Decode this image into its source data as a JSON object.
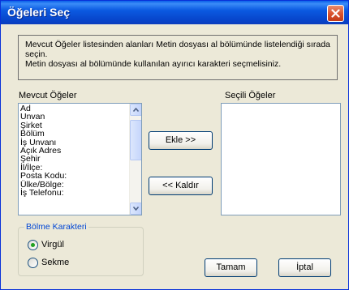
{
  "window": {
    "title": "Öğeleri Seç"
  },
  "description": {
    "line1": "Mevcut Öğeler listesinden alanları Metin dosyası al bölümünde listelendiği sırada seçin.",
    "line2": "Metin dosyası al bölümünde kullanılan ayırıcı karakteri seçmelisiniz."
  },
  "available": {
    "label": "Mevcut Öğeler",
    "items": [
      "Ad",
      "Unvan",
      "Şirket",
      "Bölüm",
      "İş Unvanı",
      "Açık Adres",
      "Şehir",
      "İl/İlçe:",
      "Posta Kodu:",
      "Ülke/Bölge:",
      "İş Telefonu:"
    ]
  },
  "selected": {
    "label": "Seçili Öğeler",
    "items": []
  },
  "buttons": {
    "add": "Ekle >>",
    "remove": "<< Kaldır",
    "ok": "Tamam",
    "cancel": "İptal"
  },
  "separator": {
    "legend": "Bölme Karakteri",
    "options": [
      {
        "label": "Virgül",
        "checked": true
      },
      {
        "label": "Sekme",
        "checked": false
      }
    ]
  },
  "colors": {
    "title_bar": "#0a5fe8",
    "dialog_bg": "#ece9d8",
    "group_label": "#0046d5",
    "radio_dot": "#21a121",
    "close_button": "#d8502c"
  }
}
